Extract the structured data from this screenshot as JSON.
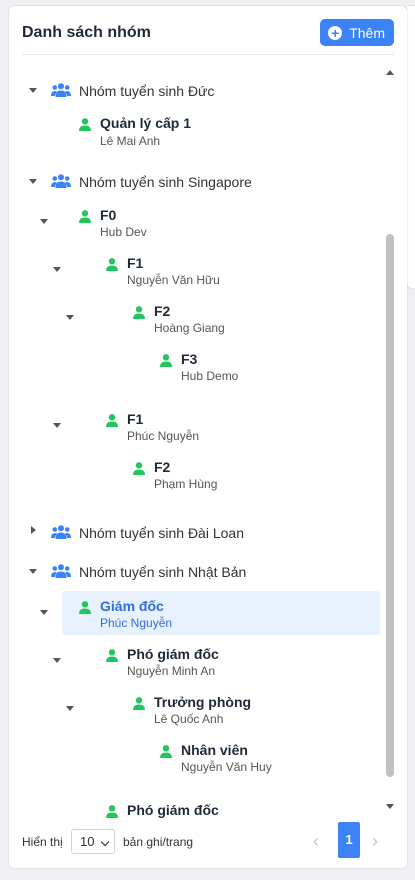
{
  "header": {
    "title": "Danh sách nhóm",
    "add_label": "Thêm"
  },
  "colors": {
    "accent": "#3b82f6",
    "person": "#22c55e",
    "selected_bg": "#e8f1fe",
    "selected_text": "#2f6ee0"
  },
  "tree": {
    "groups": [
      {
        "label": "Nhóm tuyển sinh Đức",
        "expanded": true
      },
      {
        "label": "Nhóm tuyển sinh Singapore",
        "expanded": true
      },
      {
        "label": "Nhóm tuyển sinh Đài Loan",
        "expanded": false
      },
      {
        "label": "Nhóm tuyển sinh Nhật Bản",
        "expanded": true
      }
    ],
    "nodes": [
      {
        "role": "Quản lý cấp 1",
        "name": "Lê Mai Anh"
      },
      {
        "role": "F0",
        "name": "Hub Dev"
      },
      {
        "role": "F1",
        "name": "Nguyễn Văn Hữu"
      },
      {
        "role": "F2",
        "name": "Hoàng Giang"
      },
      {
        "role": "F3",
        "name": "Hub Demo"
      },
      {
        "role": "F1",
        "name": "Phúc Nguyễn"
      },
      {
        "role": "F2",
        "name": "Phạm Hùng"
      },
      {
        "role": "Giám đốc",
        "name": "Phúc Nguyễn",
        "selected": true
      },
      {
        "role": "Phó giám đốc",
        "name": "Nguyễn Minh An"
      },
      {
        "role": "Trưởng phòng",
        "name": "Lê Quốc Anh"
      },
      {
        "role": "Nhân viên",
        "name": "Nguyễn Văn Huy"
      },
      {
        "role": "Phó giám đốc",
        "name": ""
      }
    ]
  },
  "footer": {
    "show_label": "Hiển thị",
    "page_size": "10",
    "per_page_label": "bản ghi/trang",
    "current_page": "1"
  }
}
